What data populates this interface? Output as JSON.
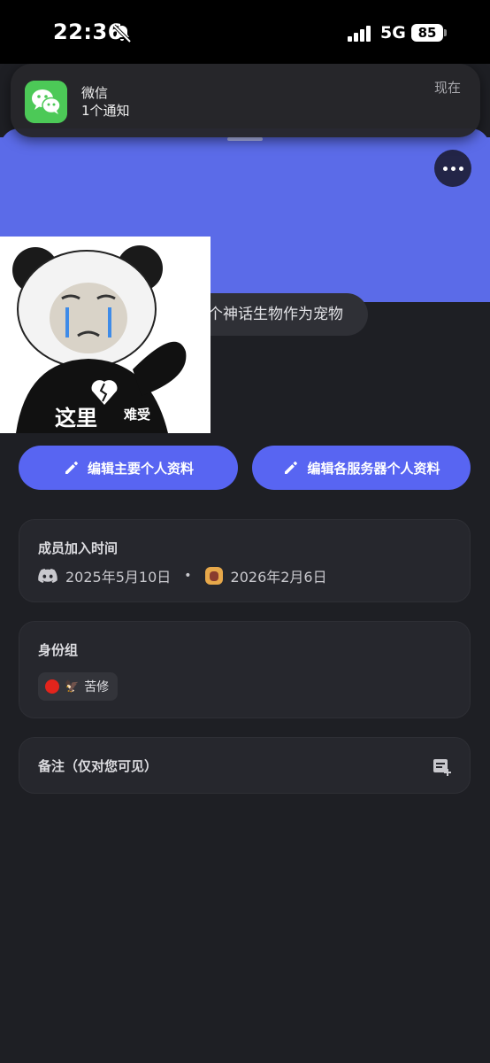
{
  "status_bar": {
    "time": "22:36",
    "network": "5G",
    "battery": "85",
    "icons": [
      "mute-bell-icon",
      "cellular-signal-icon",
      "battery-icon"
    ]
  },
  "notification": {
    "app_name": "微信",
    "message": "1个通知",
    "time": "现在",
    "icon": "wechat-icon"
  },
  "profile": {
    "banner_color": "#5b6be8",
    "status_text": "个神话生物作为宠物",
    "avatar_caption": "这里",
    "avatar_caption_small": "难受",
    "more_icon": "more-horizontal-icon"
  },
  "actions": {
    "edit_main": "编辑主要个人资料",
    "edit_server": "编辑各服务器个人资料",
    "icon": "pencil-icon",
    "accent": "#5865f2"
  },
  "member_since": {
    "title": "成员加入时间",
    "discord_date": "2025年5月10日",
    "server_date": "2026年2月6日",
    "separator": "•"
  },
  "roles": {
    "title": "身份组",
    "items": [
      {
        "name": "苦修",
        "color": "#e3241c",
        "emoji": "🦅"
      }
    ]
  },
  "note": {
    "title": "备注（仅对您可见）",
    "icon": "add-note-icon"
  }
}
